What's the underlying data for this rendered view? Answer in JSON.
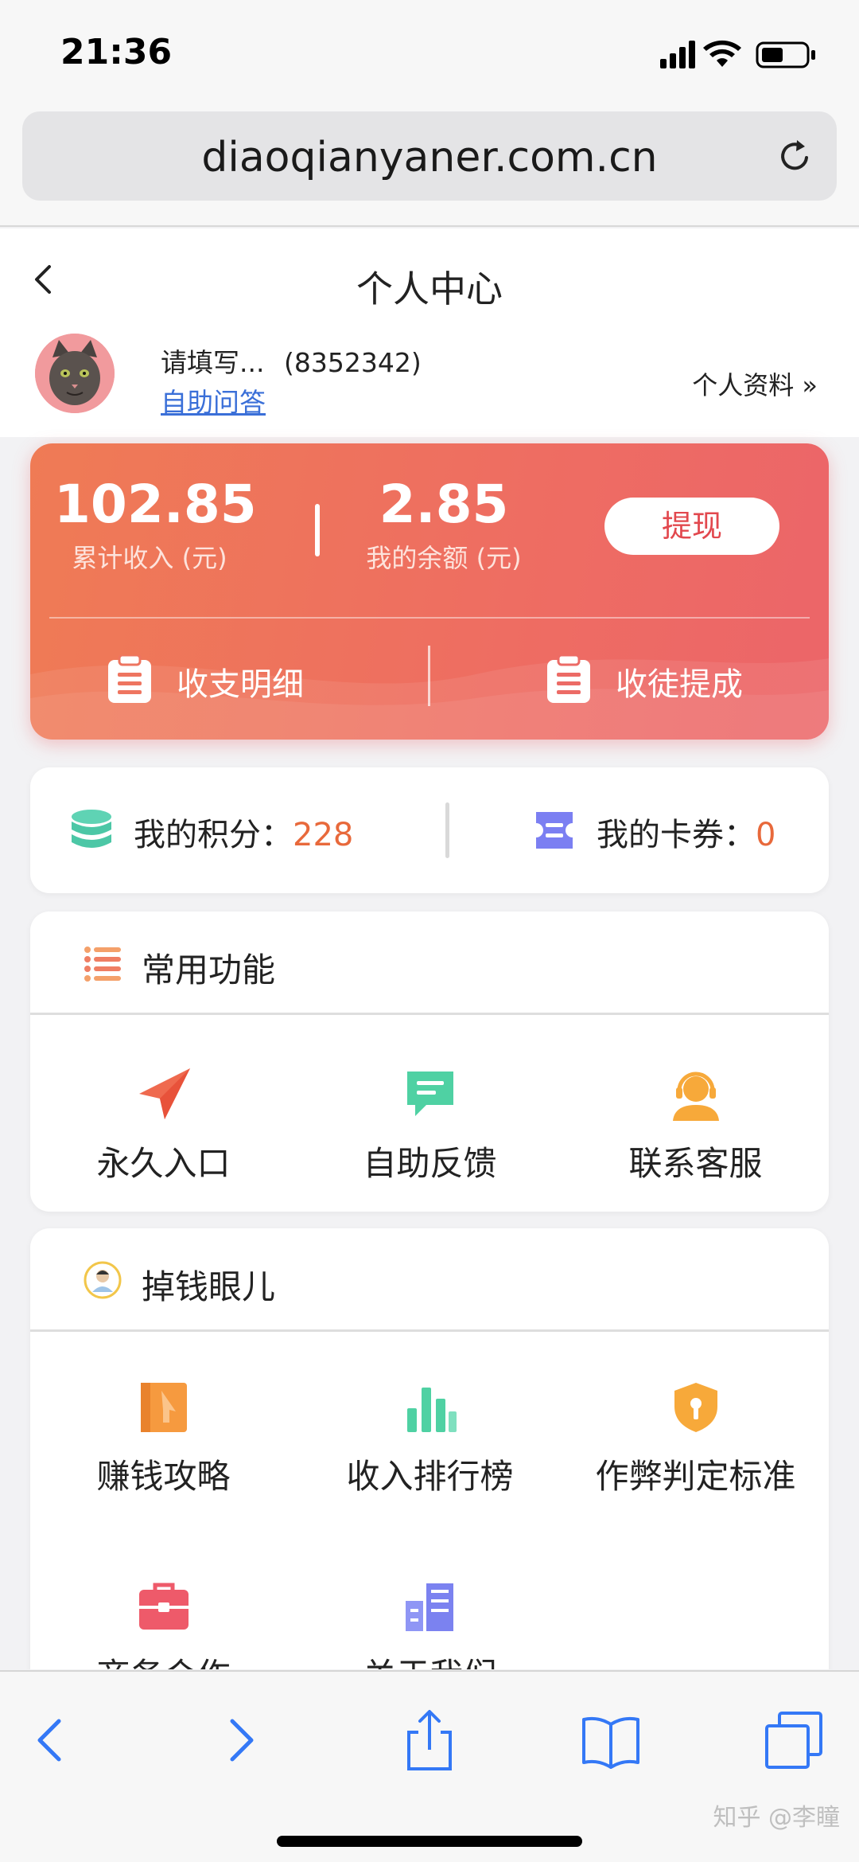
{
  "status_bar": {
    "time": "21:36"
  },
  "browser": {
    "url": "diaoqianyaner.com.cn"
  },
  "navbar": {
    "title": "个人中心"
  },
  "profile": {
    "nickname": "请填写...",
    "user_id": "(8352342)",
    "help_link": "自助问答",
    "profile_link": "个人资料 »"
  },
  "income": {
    "total_value": "102.85",
    "total_label": "累计收入 (元)",
    "balance_value": "2.85",
    "balance_label": "我的余额 (元)",
    "withdraw_label": "提现",
    "detail_label": "收支明细",
    "commission_label": "收徒提成"
  },
  "points": {
    "points_label": "我的积分：",
    "points_value": "228",
    "coupons_label": "我的卡券：",
    "coupons_value": "0"
  },
  "common_section": {
    "title": "常用功能",
    "items": [
      {
        "label": "永久入口",
        "icon": "send-icon"
      },
      {
        "label": "自助反馈",
        "icon": "message-icon"
      },
      {
        "label": "联系客服",
        "icon": "customer-service-icon"
      }
    ]
  },
  "brand_section": {
    "title": "掉钱眼儿",
    "items": [
      {
        "label": "赚钱攻略",
        "icon": "book-icon"
      },
      {
        "label": "收入排行榜",
        "icon": "bar-chart-icon"
      },
      {
        "label": "作弊判定标准",
        "icon": "shield-icon"
      },
      {
        "label": "商务合作",
        "icon": "briefcase-icon"
      },
      {
        "label": "关于我们",
        "icon": "building-icon"
      }
    ]
  },
  "watermark": "知乎 @李瞳",
  "colors": {
    "card_gradient_start": "#ef7b55",
    "card_gradient_end": "#ec6569",
    "accent_value": "#e8693b",
    "link": "#3a6fd8",
    "ios_blue": "#3478f6"
  }
}
